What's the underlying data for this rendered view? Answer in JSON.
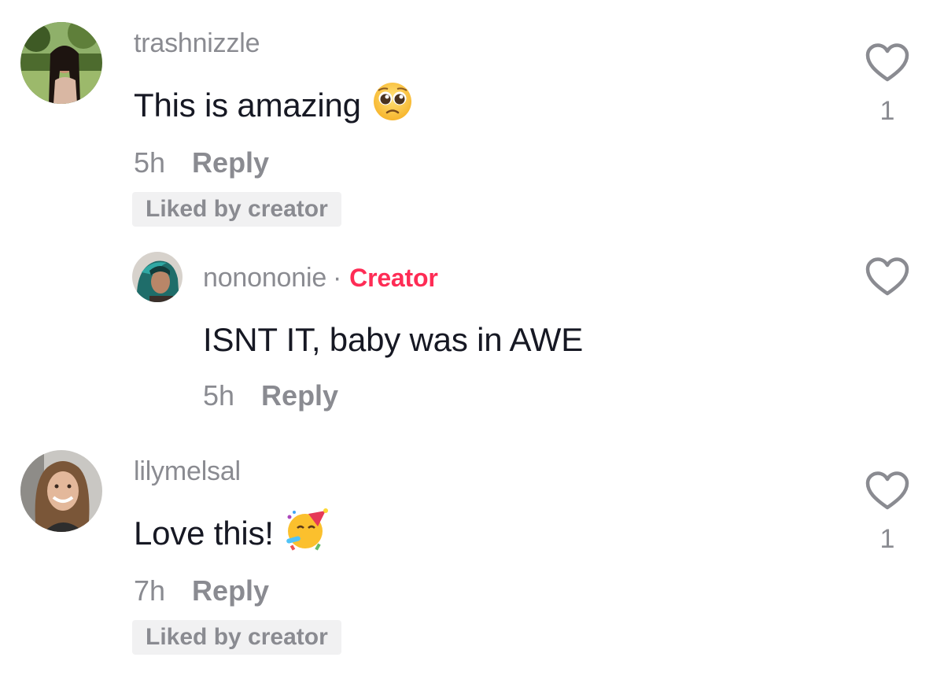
{
  "comments": [
    {
      "username": "trashnizzle",
      "text": "This is amazing",
      "emoji": "pleading-face",
      "time": "5h",
      "reply_label": "Reply",
      "liked_badge": "Liked by creator",
      "like_count": "1",
      "replies": [
        {
          "username": "nonononie",
          "separator": "·",
          "creator_badge": "Creator",
          "text": "ISNT IT, baby was in AWE",
          "time": "5h",
          "reply_label": "Reply"
        }
      ]
    },
    {
      "username": "lilymelsal",
      "text": "Love this!",
      "emoji": "partying-face",
      "time": "7h",
      "reply_label": "Reply",
      "liked_badge": "Liked by creator",
      "like_count": "1"
    }
  ],
  "colors": {
    "creator_accent": "#fe2c55",
    "muted_text": "#8a8b91",
    "primary_text": "#161823",
    "badge_bg": "#f1f1f2"
  },
  "icons": {
    "like": "heart-outline-icon"
  }
}
